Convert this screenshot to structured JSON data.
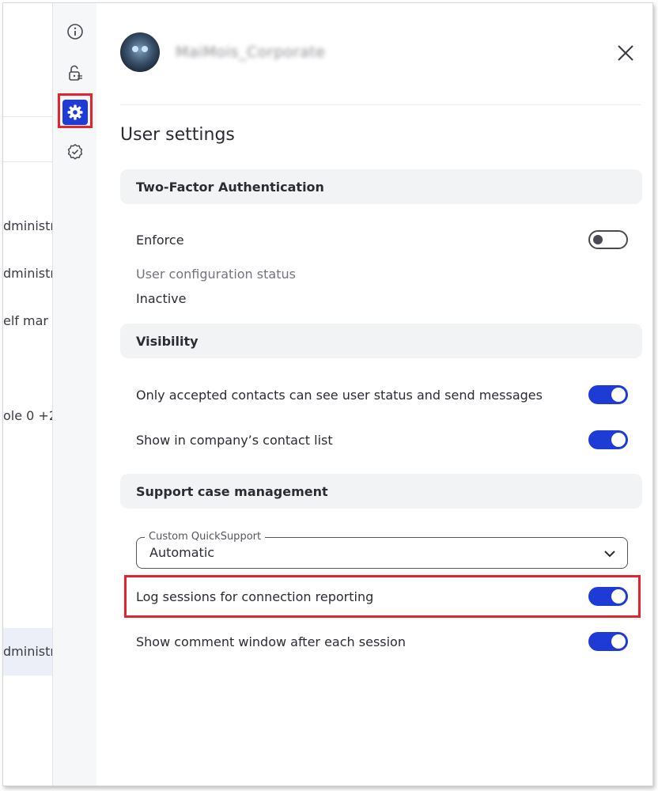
{
  "background_page": {
    "rows": [
      "dministr",
      "dministr",
      "elf mar",
      "ole 0 +2",
      "dministr"
    ]
  },
  "rail": {
    "icons": [
      "info-icon",
      "unlock-icon",
      "gear-icon",
      "verified-badge-icon"
    ]
  },
  "header": {
    "username": "MaiMois_Corporate",
    "close_label": "×"
  },
  "title": "User settings",
  "sections": {
    "two_factor": {
      "header": "Two-Factor Authentication",
      "enforce_label": "Enforce",
      "enforce_on": false,
      "status_label": "User configuration status",
      "status_value": "Inactive"
    },
    "visibility": {
      "header": "Visibility",
      "accepted_contacts_label": "Only accepted contacts can see user status and send messages",
      "accepted_contacts_on": true,
      "company_list_label": "Show in company’s contact list",
      "company_list_on": true
    },
    "support": {
      "header": "Support case management",
      "quicksupport_label": "Custom QuickSupport",
      "quicksupport_value": "Automatic",
      "log_sessions_label": "Log sessions for connection reporting",
      "log_sessions_on": true,
      "comment_window_label": "Show comment window after each session",
      "comment_window_on": true
    }
  },
  "colors": {
    "accent": "#1f3bd6",
    "highlight": "#e5232f",
    "section_bg": "#f2f3f5"
  }
}
